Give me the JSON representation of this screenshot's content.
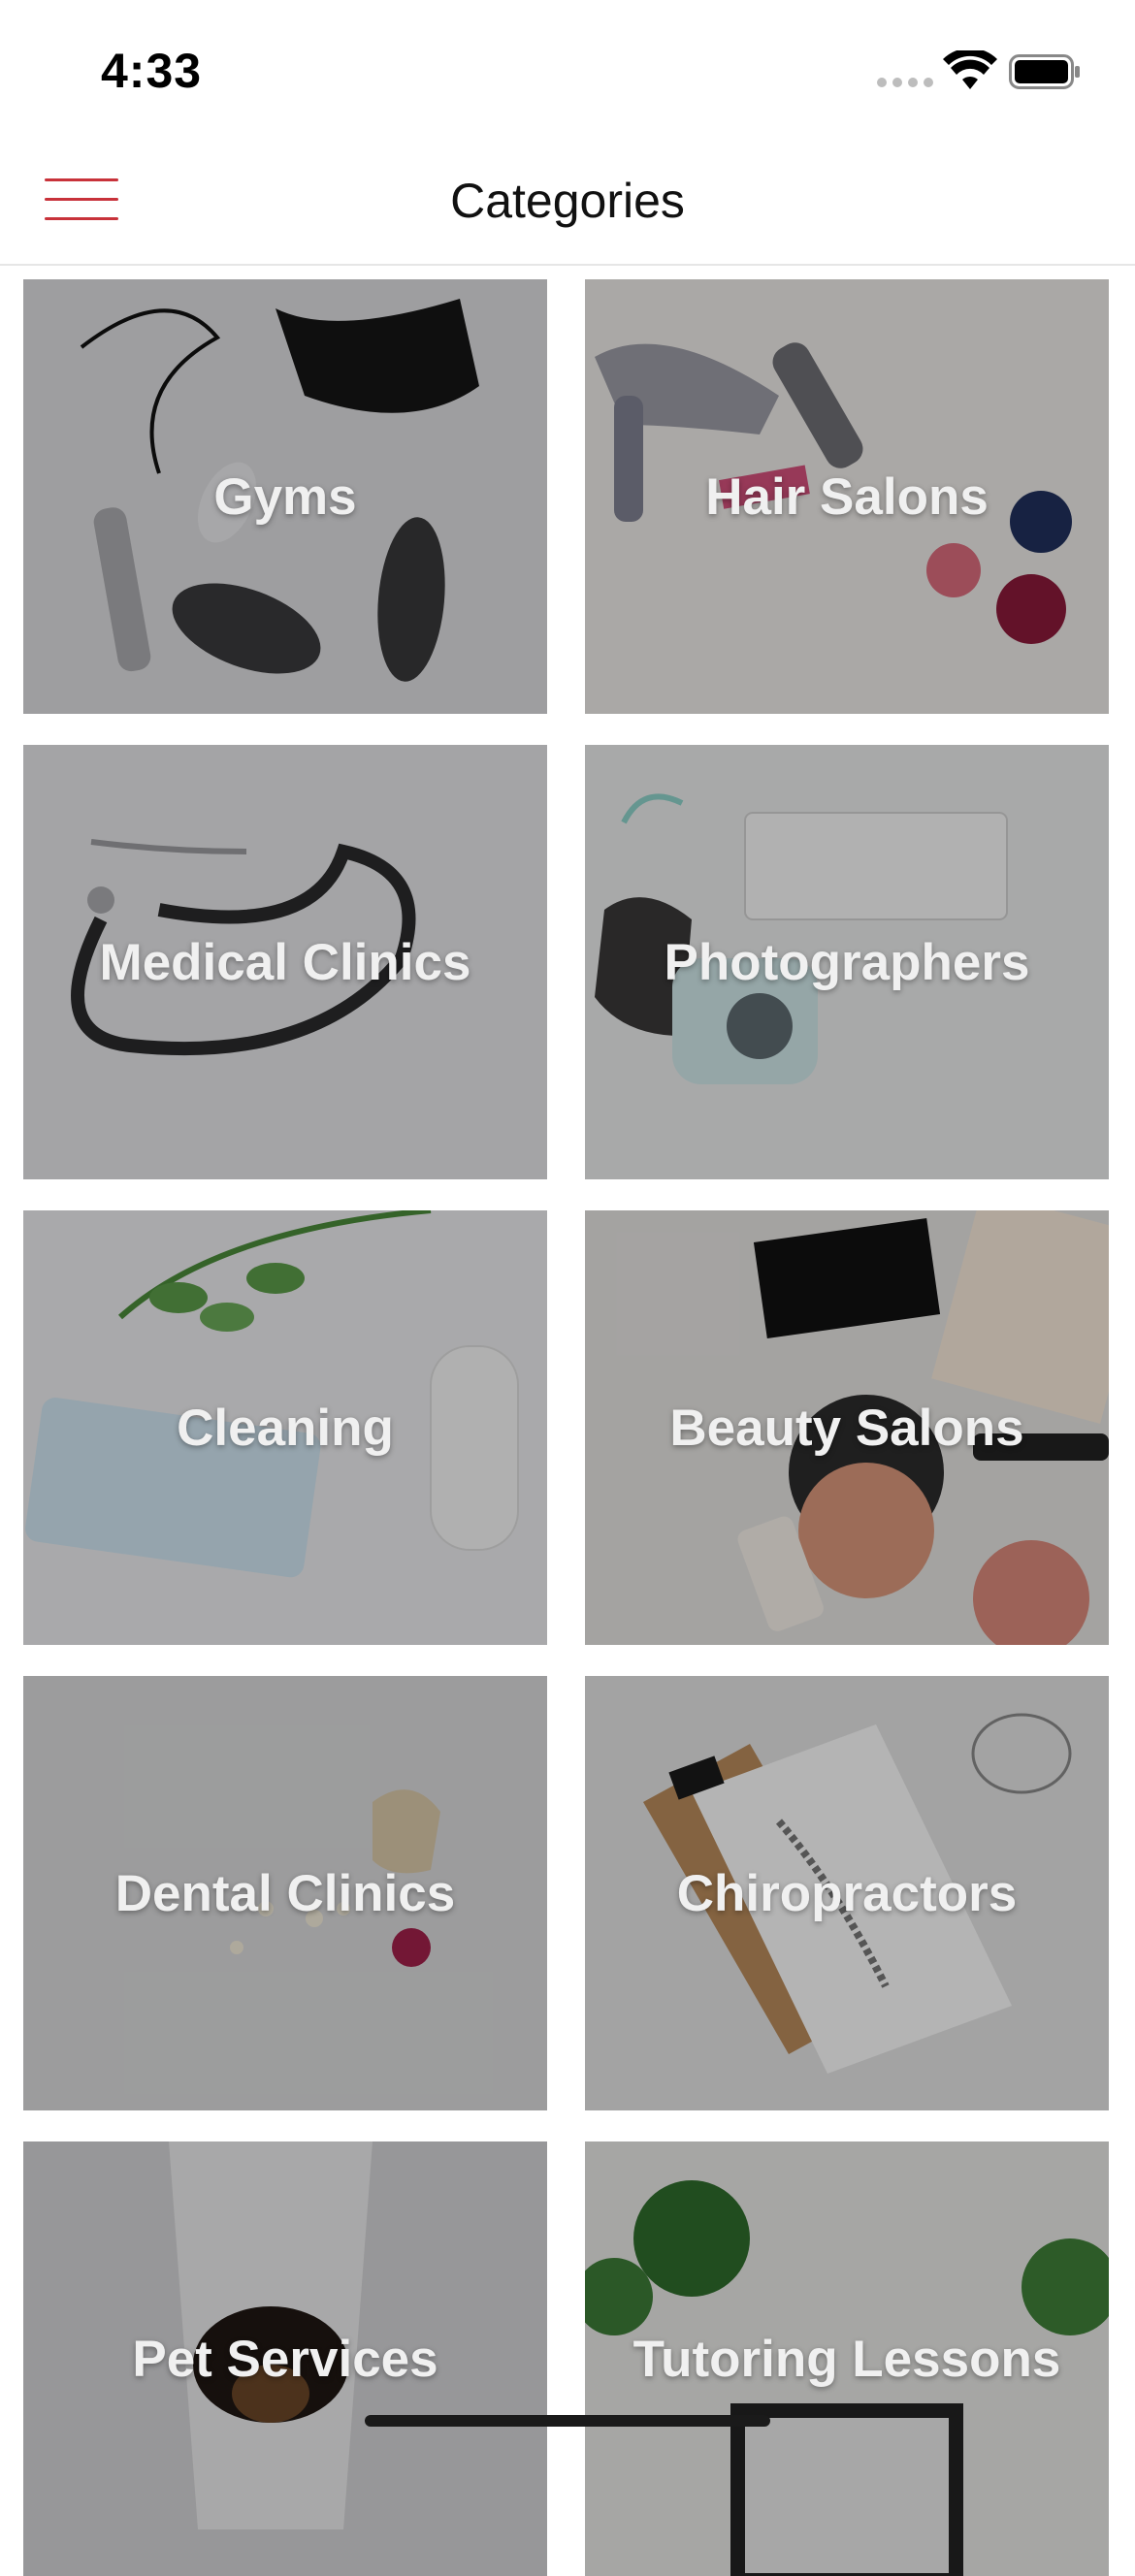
{
  "status_bar": {
    "time": "4:33",
    "icons": [
      "signal-icon",
      "wifi-icon",
      "battery-icon"
    ]
  },
  "nav": {
    "title": "Categories",
    "menu_icon": "hamburger-menu-icon",
    "accent": "#c8323a"
  },
  "categories": [
    {
      "label": "Gyms"
    },
    {
      "label": "Hair Salons"
    },
    {
      "label": "Medical Clinics"
    },
    {
      "label": "Photographers"
    },
    {
      "label": "Cleaning"
    },
    {
      "label": "Beauty Salons"
    },
    {
      "label": "Dental Clinics"
    },
    {
      "label": "Chiropractors"
    },
    {
      "label": "Pet Services"
    },
    {
      "label": "Tutoring Lessons"
    }
  ]
}
